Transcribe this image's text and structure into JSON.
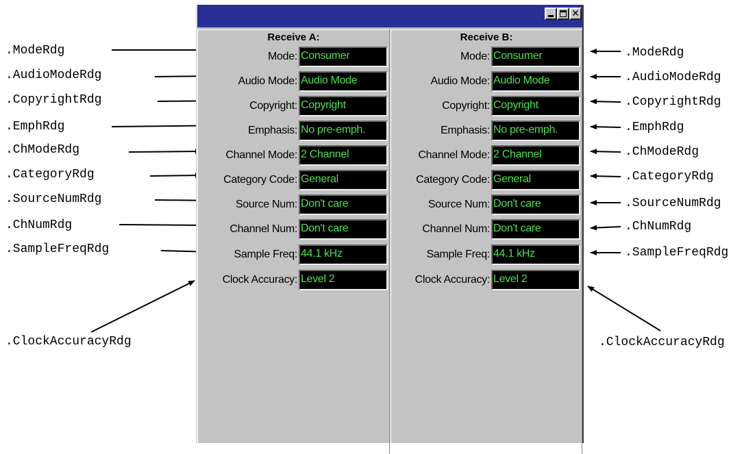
{
  "window": {
    "title": "",
    "minimize_glyph": "",
    "maximize_glyph": "",
    "close_glyph": "✕"
  },
  "receive_a": {
    "heading": "Receive A:",
    "rows": [
      {
        "label": "Mode:",
        "value": "Consumer"
      },
      {
        "label": "Audio Mode:",
        "value": "Audio Mode"
      },
      {
        "label": "Copyright:",
        "value": "Copyright"
      },
      {
        "label": "Emphasis:",
        "value": "No pre-emph."
      },
      {
        "label": "Channel Mode:",
        "value": "2 Channel"
      },
      {
        "label": "Category Code:",
        "value": "General"
      },
      {
        "label": "Source Num:",
        "value": "Don't care"
      },
      {
        "label": "Channel Num:",
        "value": "Don't care"
      },
      {
        "label": "Sample Freq:",
        "value": "44.1 kHz"
      },
      {
        "label": "Clock Accuracy:",
        "value": "Level 2"
      }
    ]
  },
  "receive_b": {
    "heading": "Receive B:",
    "rows": [
      {
        "label": "Mode:",
        "value": "Consumer"
      },
      {
        "label": "Audio Mode:",
        "value": "Audio Mode"
      },
      {
        "label": "Copyright:",
        "value": "Copyright"
      },
      {
        "label": "Emphasis:",
        "value": "No pre-emph."
      },
      {
        "label": "Channel Mode:",
        "value": "2 Channel"
      },
      {
        "label": "Category Code:",
        "value": "General"
      },
      {
        "label": "Source Num:",
        "value": "Don't care"
      },
      {
        "label": "Channel Num:",
        "value": "Don't care"
      },
      {
        "label": "Sample Freq:",
        "value": "44.1 kHz"
      },
      {
        "label": "Clock Accuracy:",
        "value": "Level 2"
      }
    ]
  },
  "annotations_left": [
    ".ModeRdg",
    ".AudioModeRdg",
    ".CopyrightRdg",
    ".EmphRdg",
    ".ChModeRdg",
    ".CategoryRdg",
    ".SourceNumRdg",
    ".ChNumRdg",
    ".SampleFreqRdg",
    ".ClockAccuracyRdg"
  ],
  "annotations_right": [
    ".ModeRdg",
    ".AudioModeRdg",
    ".CopyrightRdg",
    ".EmphRdg",
    ".ChModeRdg",
    ".CategoryRdg",
    ".SourceNumRdg",
    ".ChNumRdg",
    ".SampleFreqRdg",
    ".ClockAccuracyRdg"
  ],
  "colors": {
    "titlebar": "#2a2f93",
    "panel": "#c3c3c3",
    "readout_bg": "#000000",
    "readout_text": "#4fe04f"
  }
}
